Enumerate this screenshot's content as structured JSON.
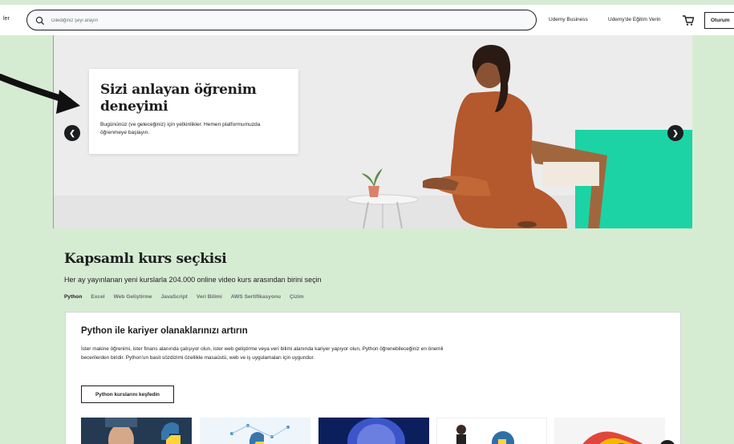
{
  "header": {
    "left_text": "ler",
    "search_placeholder": "Dilediğiniz şeyi arayın",
    "business_link": "Udemy Business",
    "teach_link": "Udemy'de Eğitim Verin",
    "login_button": "Oturum"
  },
  "hero": {
    "title": "Sizi anlayan öğrenim deneyimi",
    "text": "Bugününüz (ve geleceğiniz) için yetkinlikler. Hemen platformumuzda öğrenmeye başlayın.",
    "prev_icon": "chevron-left-icon",
    "next_icon": "chevron-right-icon"
  },
  "section": {
    "title": "Kapsamlı kurs seçkisi",
    "subtitle": "Her ay yayınlanan yeni kurslarla 204.000 online video kurs arasından birini seçin",
    "tabs": [
      "Python",
      "Excel",
      "Web Geliştirme",
      "JavaScript",
      "Veri Bilimi",
      "AWS Sertifikasyonu",
      "Çizim"
    ],
    "active_tab": "Python"
  },
  "featured": {
    "title": "Python ile kariyer olanaklarınızı artırın",
    "text": "İster makine öğrenimi, ister finans alanında çalışıyor olun, ister web geliştirme veya veri bilimi alanında kariyer yapıyor olun, Python öğrenebileceğiniz en önemli becerilerden biridir. Python'un basit sözdizimi özellikle masaüstü, web ve iş uygulamaları için uygundur.",
    "button": "Python kurslarını keşfedin"
  },
  "colors": {
    "accent_green": "#1cd3a5",
    "background_green": "#d6ecd2",
    "text_dark": "#1c1d1f"
  }
}
